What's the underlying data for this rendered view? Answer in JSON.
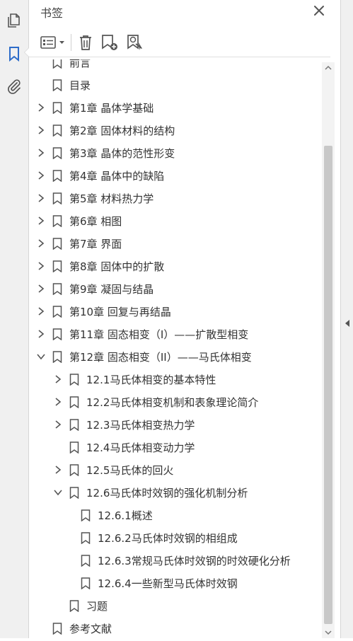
{
  "panel": {
    "title": "书签"
  },
  "tree": [
    {
      "label": "前言",
      "level": 0,
      "expander": "none"
    },
    {
      "label": "目录",
      "level": 0,
      "expander": "none"
    },
    {
      "label": "第1章  晶体学基础",
      "level": 0,
      "expander": "collapsed"
    },
    {
      "label": "第2章  固体材料的结构",
      "level": 0,
      "expander": "collapsed"
    },
    {
      "label": "第3章  晶体的范性形变",
      "level": 0,
      "expander": "collapsed"
    },
    {
      "label": "第4章  晶体中的缺陷",
      "level": 0,
      "expander": "collapsed"
    },
    {
      "label": "第5章  材料热力学",
      "level": 0,
      "expander": "collapsed"
    },
    {
      "label": "第6章  相图",
      "level": 0,
      "expander": "collapsed"
    },
    {
      "label": "第7章  界面",
      "level": 0,
      "expander": "collapsed"
    },
    {
      "label": "第8章  固体中的扩散",
      "level": 0,
      "expander": "collapsed"
    },
    {
      "label": "第9章  凝固与结晶",
      "level": 0,
      "expander": "collapsed"
    },
    {
      "label": "第10章  回复与再结晶",
      "level": 0,
      "expander": "collapsed"
    },
    {
      "label": "第11章  固态相变（I）——扩散型相变",
      "level": 0,
      "expander": "collapsed"
    },
    {
      "label": "第12章  固态相变（II）——马氏体相变",
      "level": 0,
      "expander": "expanded"
    },
    {
      "label": "12.1马氏体相变的基本特性",
      "level": 1,
      "expander": "collapsed"
    },
    {
      "label": "12.2马氏体相变机制和表象理论简介",
      "level": 1,
      "expander": "collapsed"
    },
    {
      "label": "12.3马氏体相变热力学",
      "level": 1,
      "expander": "collapsed"
    },
    {
      "label": "12.4马氏体相变动力学",
      "level": 1,
      "expander": "none"
    },
    {
      "label": "12.5马氏体的回火",
      "level": 1,
      "expander": "collapsed"
    },
    {
      "label": "12.6马氏体时效钢的强化机制分析",
      "level": 1,
      "expander": "expanded"
    },
    {
      "label": "12.6.1概述",
      "level": 2,
      "expander": "none"
    },
    {
      "label": "12.6.2马氏体时效钢的相组成",
      "level": 2,
      "expander": "none"
    },
    {
      "label": "12.6.3常规马氏体时效钢的时效硬化分析",
      "level": 2,
      "expander": "none"
    },
    {
      "label": "12.6.4一些新型马氏体时效钢",
      "level": 2,
      "expander": "none"
    },
    {
      "label": "习题",
      "level": 1,
      "expander": "none"
    },
    {
      "label": "参考文献",
      "level": 0,
      "expander": "none"
    }
  ],
  "colors": {
    "accent": "#2d6cc9",
    "icon": "#555555",
    "text": "#333333"
  }
}
